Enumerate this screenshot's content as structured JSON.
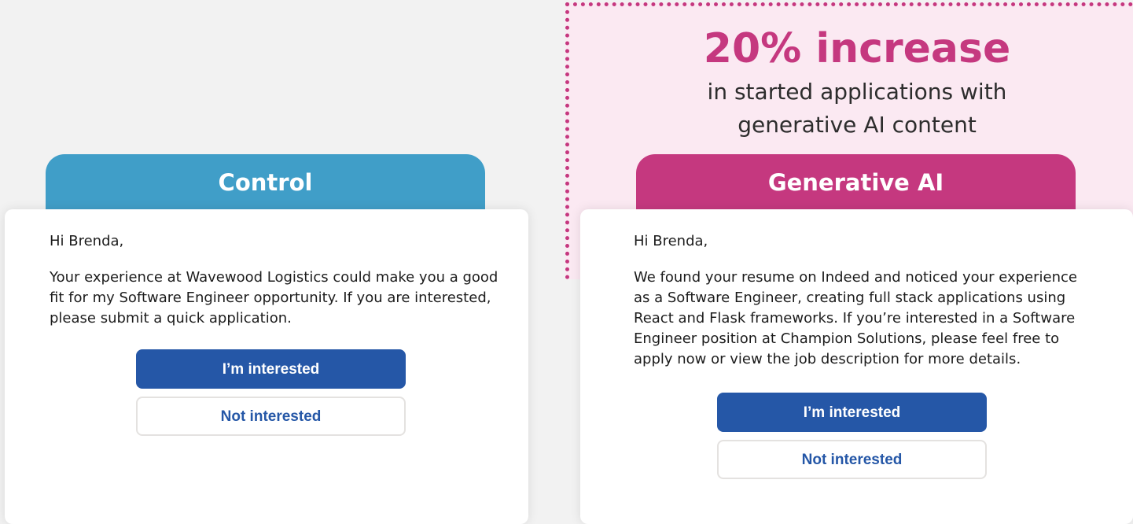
{
  "highlight": {
    "headline": "20% increase",
    "subline_1": "in started applications with",
    "subline_2": "generative AI content"
  },
  "control": {
    "tab_label": "Control",
    "greeting": "Hi Brenda,",
    "message_lines": [
      "Your experience at Wavewood Logistics could make you a good",
      "fit for my Software Engineer opportunity. If you are interested,",
      "please submit a quick application."
    ],
    "primary_button": "I’m interested",
    "secondary_button": "Not interested"
  },
  "generative_ai": {
    "tab_label": "Generative AI",
    "greeting": "Hi Brenda,",
    "message_lines": [
      "We found your resume on Indeed and noticed your experience",
      "as a Software Engineer, creating full stack applications using",
      "React and Flask frameworks. If you’re interested in a Software",
      "Engineer position at Champion Solutions, please feel free to",
      "apply now or view the job description for more details."
    ],
    "primary_button": "I’m interested",
    "secondary_button": "Not interested"
  },
  "colors": {
    "brand_pink": "#c5387f",
    "control_blue": "#409ec8",
    "button_blue": "#2557a7",
    "highlight_bg": "#fbe9f2",
    "page_bg": "#f2f2f2"
  }
}
